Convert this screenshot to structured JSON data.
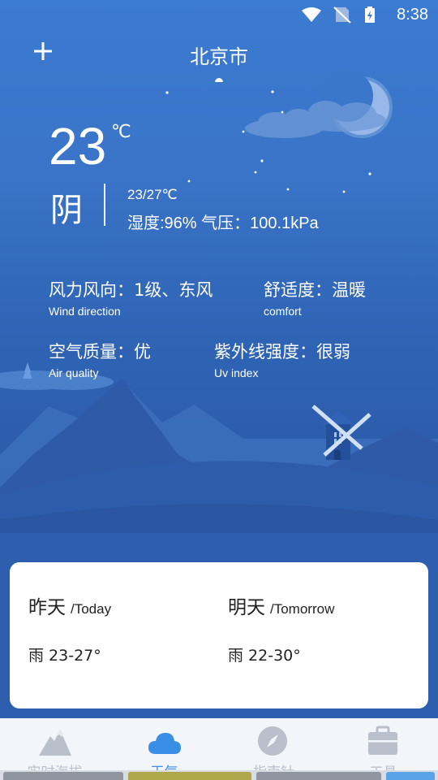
{
  "status_bar": {
    "time": "8:38"
  },
  "header": {
    "city": "北京市"
  },
  "current": {
    "temperature": "23",
    "unit": "℃",
    "condition": "阴",
    "range": "23/27℃",
    "humidity_pressure": "湿度:96% 气压：100.1kPa"
  },
  "details": [
    {
      "value": "风力风向：1级、东风",
      "label": "Wind direction"
    },
    {
      "value": "舒适度：温暖",
      "label": "comfort"
    },
    {
      "value": "空气质量：优",
      "label": "Air quality"
    },
    {
      "value": "紫外线强度：很弱",
      "label": "Uv index"
    }
  ],
  "forecast": [
    {
      "day": "昨天",
      "day_en": "/Today",
      "weather": "雨 23-27°"
    },
    {
      "day": "明天",
      "day_en": "/Tomorrow",
      "weather": "雨 22-30°"
    }
  ],
  "nav": [
    {
      "label": "实时海拔",
      "icon": "mountain-icon"
    },
    {
      "label": "天气",
      "icon": "cloud-icon",
      "active": true
    },
    {
      "label": "指南针",
      "icon": "compass-icon"
    },
    {
      "label": "工具",
      "icon": "toolbox-icon"
    }
  ],
  "colors": {
    "accent": "#3a8ee6",
    "sky": "#3a74c8",
    "card": "#ffffff"
  }
}
